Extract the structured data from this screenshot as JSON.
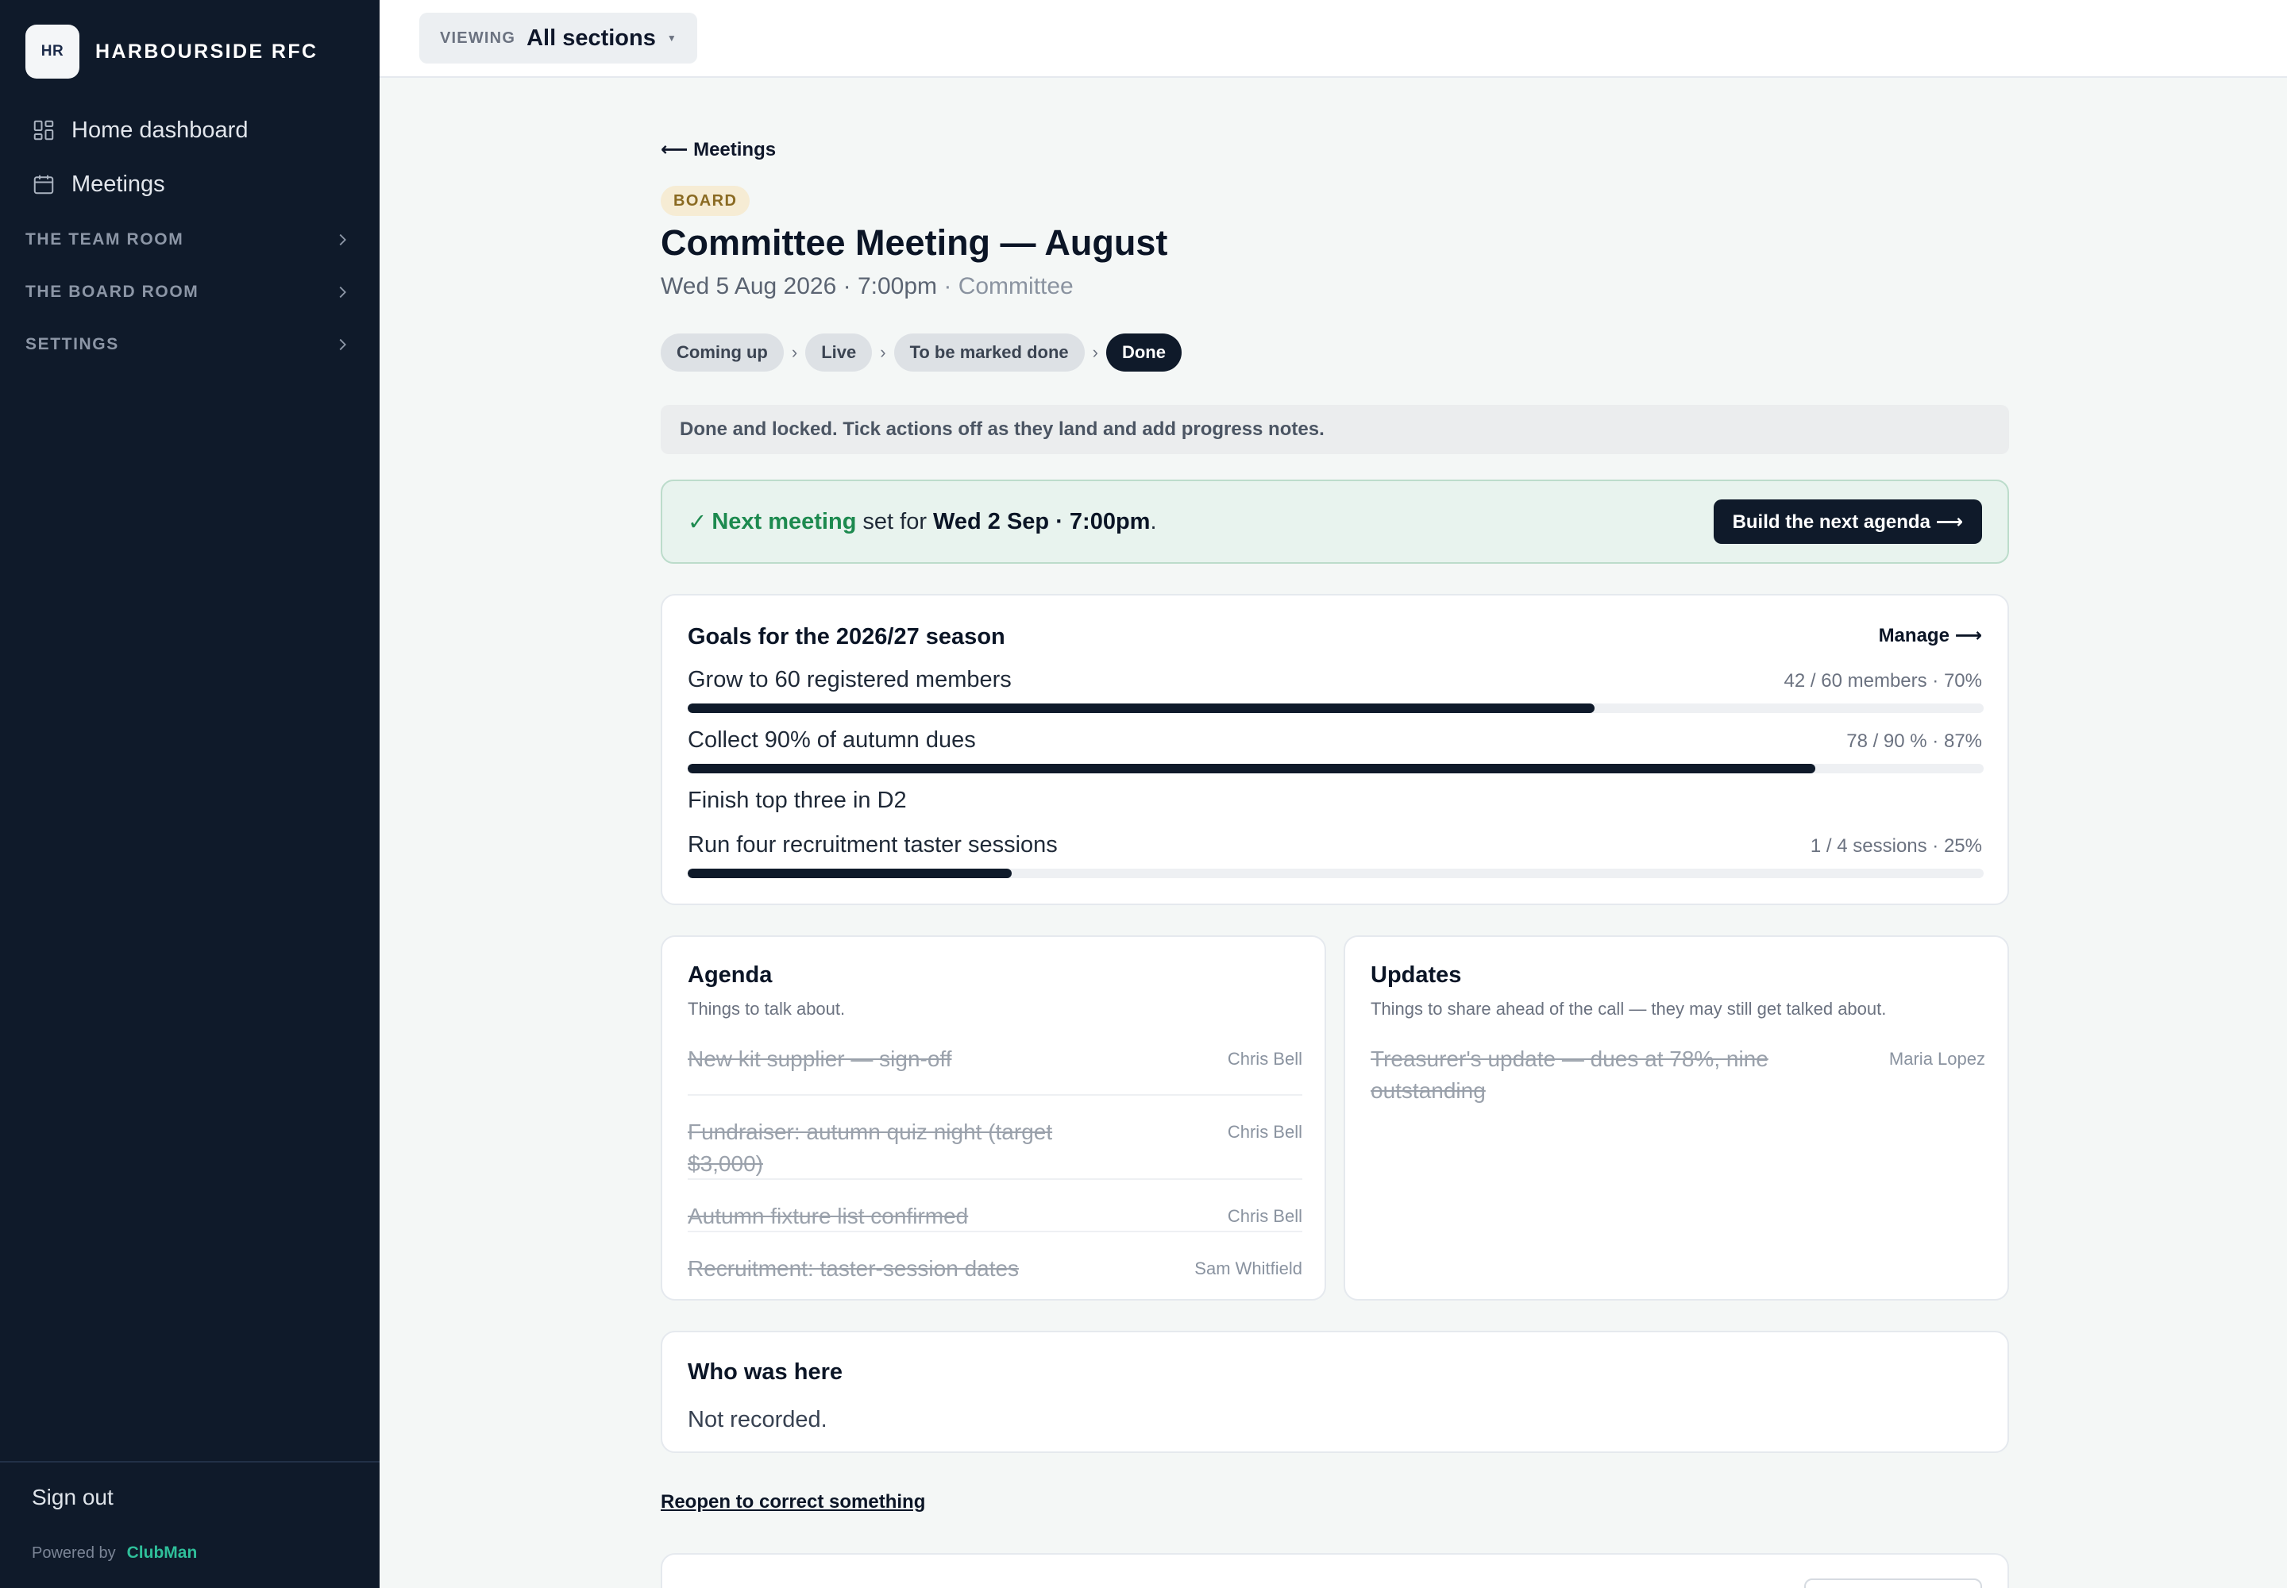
{
  "brand": {
    "initials": "HR",
    "name": "HARBOURSIDE RFC"
  },
  "sidebar": {
    "items": [
      {
        "label": "Home dashboard",
        "icon": "grid-icon"
      },
      {
        "label": "Meetings",
        "icon": "calendar-icon"
      }
    ],
    "groups": [
      {
        "label": "THE TEAM ROOM"
      },
      {
        "label": "THE BOARD ROOM"
      },
      {
        "label": "SETTINGS"
      }
    ],
    "signout": "Sign out",
    "powered_by": "Powered by",
    "powered_brand": "ClubMan"
  },
  "topbar": {
    "viewing_label": "VIEWING",
    "viewing_value": "All sections"
  },
  "meeting": {
    "back_link": "⟵ Meetings",
    "tag": "BOARD",
    "title": "Committee Meeting — August",
    "date": "Wed 5 Aug 2026 · 7:00pm",
    "separator": " · ",
    "type": "Committee",
    "steps": [
      "Coming up",
      "Live",
      "To be marked done",
      "Done"
    ],
    "step_separator": "›",
    "notice": "Done and locked. Tick actions off as they land and add progress notes.",
    "next": {
      "check": "✓",
      "label": "Next meeting",
      "text": "set for",
      "date": "Wed 2 Sep · 7:00pm",
      "period": ".",
      "button": "Build the next agenda ⟶"
    }
  },
  "goals": {
    "title": "Goals for the 2026/27 season",
    "manage": "Manage ⟶",
    "items": [
      {
        "name": "Grow to 60 registered members",
        "meta": "42 / 60 members · 70%",
        "progress": 0.7
      },
      {
        "name": "Collect 90% of autumn dues",
        "meta": "78 / 90 % · 87%",
        "progress": 0.87
      },
      {
        "name": "Finish top three in D2",
        "meta": ""
      },
      {
        "name": "Run four recruitment taster sessions",
        "meta": "1 / 4 sessions · 25%",
        "progress": 0.25
      }
    ]
  },
  "agenda": {
    "title": "Agenda",
    "subtitle": "Things to talk about.",
    "items": [
      {
        "title": "New kit supplier — sign-off",
        "owner": "Chris Bell"
      },
      {
        "title": "Fundraiser: autumn quiz night (target $3,000)",
        "owner": "Chris Bell"
      },
      {
        "title": "Autumn fixture list confirmed",
        "owner": "Chris Bell"
      },
      {
        "title": "Recruitment: taster-session dates",
        "owner": "Sam Whitfield"
      }
    ]
  },
  "updates": {
    "title": "Updates",
    "subtitle": "Things to share ahead of the call — they may still get talked about.",
    "items": [
      {
        "title": "Treasurer's update — dues at 78%, nine outstanding",
        "owner": "Maria Lopez"
      }
    ]
  },
  "attendance": {
    "title": "Who was here",
    "text": "Not recorded."
  },
  "reopen": "Reopen to correct something"
}
